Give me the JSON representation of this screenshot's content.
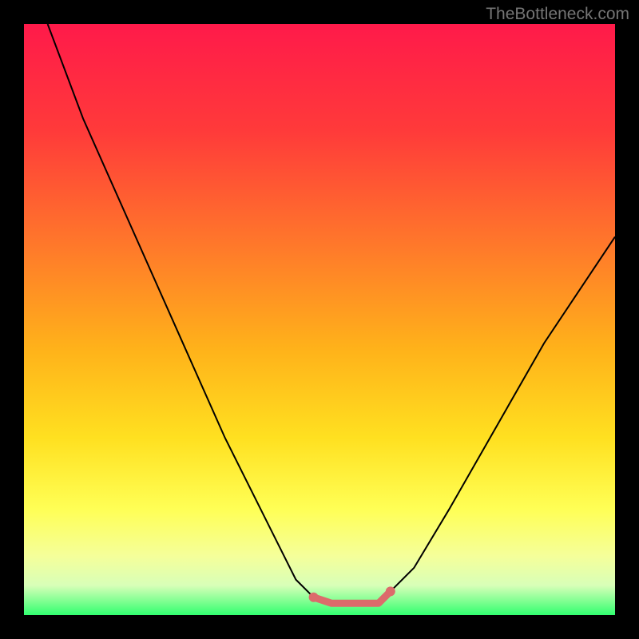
{
  "watermark": "TheBottleneck.com",
  "chart_data": {
    "type": "line",
    "title": "",
    "xlabel": "",
    "ylabel": "",
    "xlim": [
      0,
      100
    ],
    "ylim": [
      0,
      100
    ],
    "background_gradient": {
      "top": "#FF1A4A",
      "mid_upper": "#FF6A2A",
      "mid": "#FFC81A",
      "mid_lower": "#FFFF55",
      "lower": "#F5FF9A",
      "bottom_band": "#32FF70"
    },
    "series": [
      {
        "name": "bottleneck-curve",
        "color": "#000000",
        "points": [
          {
            "x": 4,
            "y": 100
          },
          {
            "x": 10,
            "y": 84
          },
          {
            "x": 18,
            "y": 66
          },
          {
            "x": 26,
            "y": 48
          },
          {
            "x": 34,
            "y": 30
          },
          {
            "x": 42,
            "y": 14
          },
          {
            "x": 46,
            "y": 6
          },
          {
            "x": 49,
            "y": 3
          },
          {
            "x": 52,
            "y": 2
          },
          {
            "x": 56,
            "y": 2
          },
          {
            "x": 60,
            "y": 2
          },
          {
            "x": 62,
            "y": 4
          },
          {
            "x": 66,
            "y": 8
          },
          {
            "x": 72,
            "y": 18
          },
          {
            "x": 80,
            "y": 32
          },
          {
            "x": 88,
            "y": 46
          },
          {
            "x": 96,
            "y": 58
          },
          {
            "x": 100,
            "y": 64
          }
        ]
      },
      {
        "name": "optimal-highlight",
        "color": "#DC6B6B",
        "highlight": true,
        "points": [
          {
            "x": 49,
            "y": 3
          },
          {
            "x": 52,
            "y": 2
          },
          {
            "x": 56,
            "y": 2
          },
          {
            "x": 60,
            "y": 2
          },
          {
            "x": 62,
            "y": 4
          }
        ]
      }
    ]
  }
}
